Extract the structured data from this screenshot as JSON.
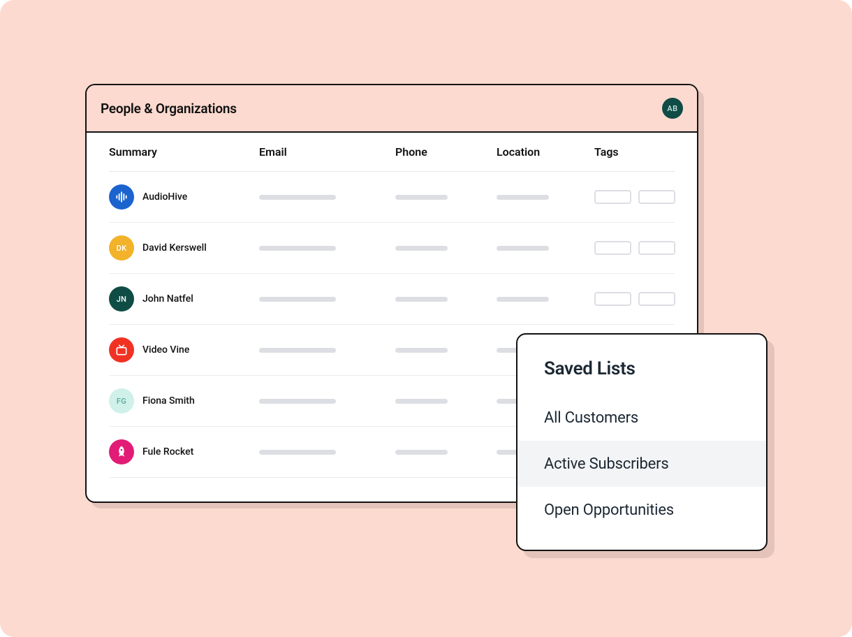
{
  "panel": {
    "title": "People & Organizations",
    "user_initials": "AB"
  },
  "columns": {
    "summary": "Summary",
    "email": "Email",
    "phone": "Phone",
    "location": "Location",
    "tags": "Tags"
  },
  "rows": [
    {
      "name": "AudioHive",
      "avatar": {
        "type": "icon",
        "icon": "audio-bars-icon",
        "bg": "#1b63ce",
        "fg": "#ffffff"
      },
      "show_tags": true
    },
    {
      "name": "David Kerswell",
      "avatar": {
        "type": "initials",
        "initials": "DK",
        "bg": "#f2b22a",
        "fg": "#ffffff"
      },
      "show_tags": true
    },
    {
      "name": "John Natfel",
      "avatar": {
        "type": "initials",
        "initials": "JN",
        "bg": "#0f4c45",
        "fg": "#ffffff"
      },
      "show_tags": true
    },
    {
      "name": "Video Vine",
      "avatar": {
        "type": "icon",
        "icon": "tv-icon",
        "bg": "#f13223",
        "fg": "#ffffff"
      },
      "show_tags": false
    },
    {
      "name": "Fiona Smith",
      "avatar": {
        "type": "initials",
        "initials": "FG",
        "bg": "#d0f0ea",
        "fg": "#5aa89c"
      },
      "show_tags": false
    },
    {
      "name": "Fule Rocket",
      "avatar": {
        "type": "icon",
        "icon": "rocket-icon",
        "bg": "#e21b76",
        "fg": "#ffffff"
      },
      "show_tags": false
    }
  ],
  "popover": {
    "title": "Saved Lists",
    "items": [
      {
        "label": "All Customers",
        "selected": false
      },
      {
        "label": "Active Subscribers",
        "selected": true
      },
      {
        "label": "Open Opportunities",
        "selected": false
      }
    ]
  }
}
